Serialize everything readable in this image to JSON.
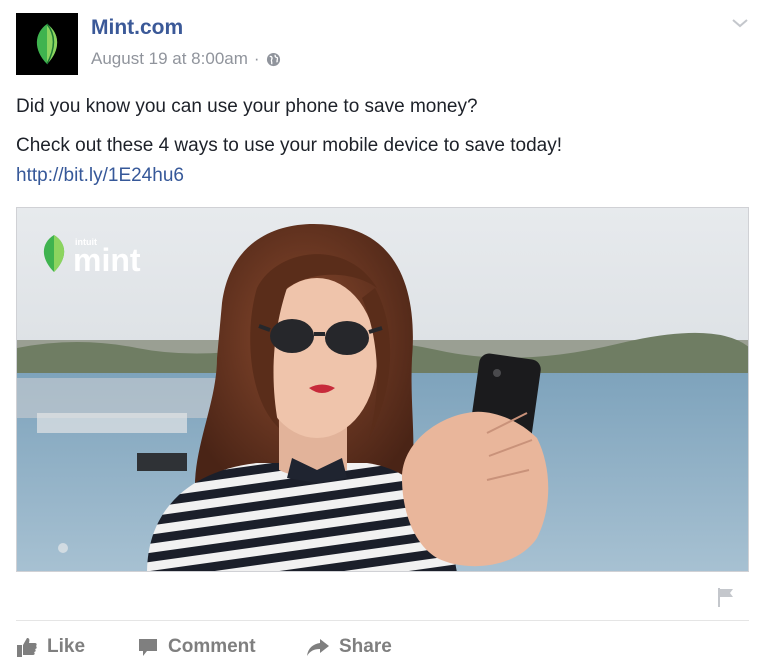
{
  "post": {
    "page_name": "Mint.com",
    "timestamp": "August 19 at 8:00am",
    "separator": "·",
    "audience_icon": "globe-icon",
    "menu_icon": "chevron-down-icon",
    "avatar_icon": "mint-leaf-logo",
    "text_line1": "Did you know you can use your phone to save money?",
    "text_line2": "Check out these 4 ways to use your mobile device to save today!",
    "link": "http://bit.ly/1E24hu6"
  },
  "photo": {
    "logo_small": "intuit",
    "logo_text": "mint",
    "description_icon": "woman-with-phone-photo"
  },
  "actions": {
    "like_label": "Like",
    "comment_label": "Comment",
    "share_label": "Share",
    "report_icon": "flag-icon"
  },
  "colors": {
    "link_blue": "#365899",
    "name_blue": "#3b5998",
    "meta_gray": "#90949c",
    "action_gray": "#7f7f7f",
    "mint_green": "#5cc04a"
  }
}
